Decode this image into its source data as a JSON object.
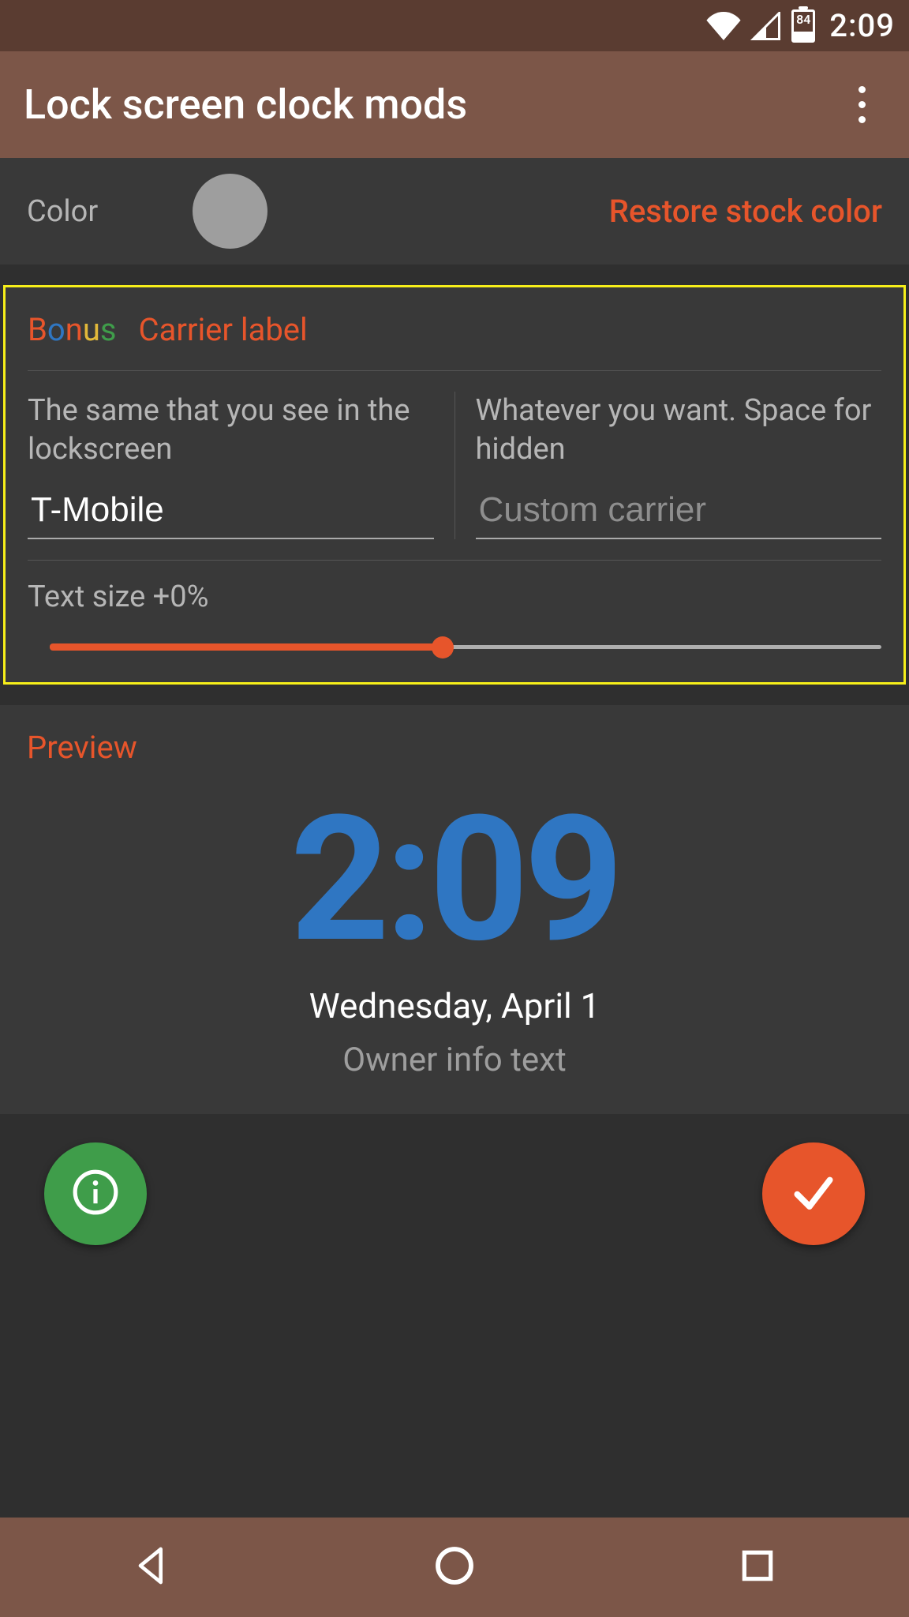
{
  "status": {
    "battery_pct": "84",
    "time": "2:09"
  },
  "appbar": {
    "title": "Lock screen clock mods"
  },
  "color": {
    "label": "Color",
    "restore": "Restore stock color",
    "swatch_hex": "#9e9e9e"
  },
  "bonus": {
    "word": {
      "c0": "B",
      "c1": "o",
      "c2": "n",
      "c3": "u",
      "c4": "s"
    },
    "subtitle": "Carrier label",
    "left_desc": "The same that you see in the lockscreen",
    "left_value": "T-Mobile",
    "right_desc": "Whatever you want. Space for hidden",
    "right_placeholder": "Custom carrier",
    "slider_label": "Text size +0%"
  },
  "preview": {
    "label": "Preview",
    "clock": "2:09",
    "date": "Wednesday, April 1",
    "owner": "Owner info text"
  },
  "accent": "#e7552b",
  "clock_color": "#2f76c2"
}
